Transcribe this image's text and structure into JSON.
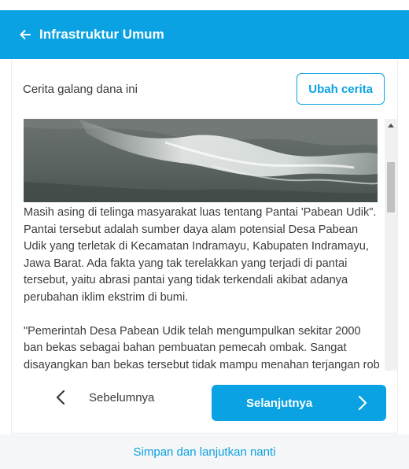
{
  "header": {
    "title": "Infrastruktur Umum",
    "back_icon": "arrow-left-icon",
    "color": "#0aa2e2"
  },
  "section": {
    "title": "Cerita galang dana ini",
    "edit_label": "Ubah cerita"
  },
  "story": {
    "paragraphs": [
      "Masih asing di telinga masyarakat luas tentang Pantai 'Pabean Udik\". Pantai tersebut adalah sumber daya alam potensial Desa Pabean Udik yang terletak di Kecamatan Indramayu, Kabupaten Indramayu, Jawa Barat. Ada fakta yang tak terelakkan yang terjadi di pantai tersebut, yaitu abrasi pantai yang tidak terkendali akibat adanya perubahan iklim ekstrim di bumi.",
      "\"Pemerintah Desa Pabean Udik telah mengumpulkan sekitar 2000 ban bekas sebagai bahan pembuatan pemecah ombak. Sangat disayangkan ban bekas tersebut tidak mampu menahan terjangan rob yang kuat dan justru tampak seperti ban tidak"
    ]
  },
  "navigation": {
    "prev_label": "Sebelumnya",
    "next_label": "Selanjutnya"
  },
  "footer": {
    "save_label": "Simpan dan lanjutkan nanti"
  }
}
